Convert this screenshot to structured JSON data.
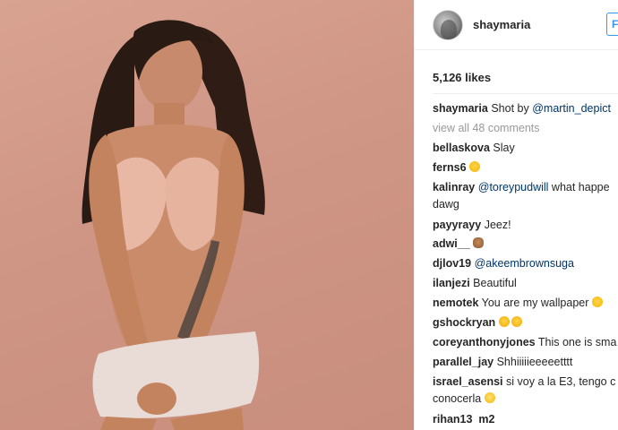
{
  "post": {
    "username": "shaymaria",
    "follow_label": "F",
    "likes": "5,126 likes"
  },
  "caption": {
    "user": "shaymaria",
    "text": "Shot by ",
    "mention": "@martin_depict"
  },
  "view_all": "view all 48 comments",
  "comments": [
    {
      "user": "bellaskova",
      "text": "Slay",
      "link": "",
      "emoji": ""
    },
    {
      "user": "ferns6",
      "text": "",
      "link": "",
      "emoji": "smile"
    },
    {
      "user": "kalinray",
      "text": " what happe",
      "link": "@toreypudwill",
      "emoji": "",
      "cont": "dawg"
    },
    {
      "user": "payyrayy",
      "text": "Jeez!",
      "link": "",
      "emoji": ""
    },
    {
      "user": "adwi__",
      "text": "",
      "link": "",
      "emoji": "monkey"
    },
    {
      "user": "djlov19",
      "text": "",
      "link": "@akeembrownsuga",
      "emoji": ""
    },
    {
      "user": "ilanjezi",
      "text": "Beautiful",
      "link": "",
      "emoji": ""
    },
    {
      "user": "nemotek",
      "text": "You are my wallpaper",
      "link": "",
      "emoji": "smile"
    },
    {
      "user": "gshockryan",
      "text": "",
      "link": "",
      "emoji": "grin2"
    },
    {
      "user": "coreyanthonyjones",
      "text": "This one is sma",
      "link": "",
      "emoji": ""
    },
    {
      "user": "parallel_jay",
      "text": "Shhiiiiieeeeetttt",
      "link": "",
      "emoji": ""
    },
    {
      "user": "israel_asensi",
      "text": "si voy a la E3, tengo c",
      "link": "",
      "emoji": "",
      "cont": "conocerla"
    },
    {
      "user": "rihan13_m2",
      "text": "",
      "link": "",
      "emoji": ""
    }
  ],
  "colors": {
    "link": "#003569",
    "muted": "#999999",
    "text": "#262626",
    "accent": "#3897f0",
    "photo_bg": "#d39a89"
  }
}
